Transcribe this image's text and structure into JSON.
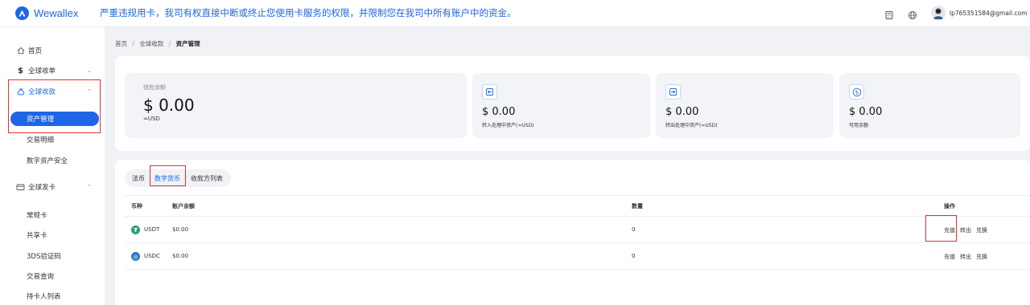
{
  "app": {
    "name": "Wewallex",
    "brand_color": "#1d66e5",
    "danger_color": "#e0322f"
  },
  "notice": "严重违规用卡，我司有权直接中断或终止您使用卡服务的权限，并限制您在我司中所有账户中的资金。",
  "topbar": {
    "icons": [
      "calculator-icon",
      "globe-icon"
    ],
    "user_email": "lp765351584@gmail.com"
  },
  "sidebar": {
    "home": "首页",
    "global_collection_order": "全球收单",
    "global_receipt": "全球收款",
    "asset_management": "资产管理",
    "transaction_details": "交易明细",
    "digital_asset_security": "数字资产安全",
    "global_card": "全球发卡",
    "regular_card": "常规卡",
    "shared_card": "共享卡",
    "verify_3ds": "3DS验证码",
    "transaction_query": "交易查询",
    "cardholder_list": "持卡人列表"
  },
  "breadcrumb": {
    "home": "首页",
    "sep": "/",
    "parent": "全球收款",
    "current": "资产管理"
  },
  "summary": {
    "wallet_label": "钱包余额",
    "wallet_value": "$ 0.00",
    "wallet_unit": "≈USD",
    "cards": [
      {
        "value": "$ 0.00",
        "label": "转入处理中资产(≈USD)",
        "icon": "transfer-in-icon"
      },
      {
        "value": "$ 0.00",
        "label": "转出处理中资产(≈USD)",
        "icon": "transfer-out-icon"
      },
      {
        "value": "$ 0.00",
        "label": "可用余额",
        "icon": "dollar-circle-icon"
      }
    ]
  },
  "tabs": [
    "法币",
    "数字货币",
    "收款方列表"
  ],
  "active_tab": "数字货币",
  "table": {
    "headers": {
      "currency": "币种",
      "balance": "账户余额",
      "quantity": "数量",
      "actions": "操作"
    },
    "rows": [
      {
        "coin": "USDT",
        "balance": "$0.00",
        "quantity": "0",
        "icon_color": "#26a17b"
      },
      {
        "coin": "USDC",
        "balance": "$0.00",
        "quantity": "0",
        "icon_color": "#2775ca"
      }
    ],
    "actions": {
      "recharge": "充值",
      "transfer_out": "转出",
      "exchange": "兑换"
    }
  }
}
